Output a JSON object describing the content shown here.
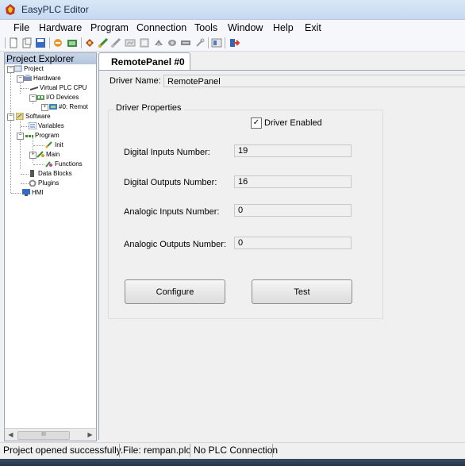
{
  "window": {
    "title": "EasyPLC Editor",
    "accent": "#c6d9f0"
  },
  "menu": [
    "File",
    "Hardware",
    "Program",
    "Connection",
    "Tools",
    "Window",
    "Help",
    "Exit"
  ],
  "toolbar_icons": [
    "new-icon",
    "open-icon",
    "save-icon",
    "compile-icon",
    "build-icon",
    "plc-icon",
    "run-icon",
    "stop-icon",
    "monitor-icon",
    "settings-icon",
    "plugin-icon",
    "chip-icon",
    "wrench-icon",
    "panel-icon",
    "exit-icon"
  ],
  "explorer": {
    "title": "Project Explorer",
    "tree": [
      {
        "label": "Project",
        "icon": "project-icon"
      },
      {
        "label": "Hardware",
        "icon": "hardware-icon"
      },
      {
        "label": "Virtual PLC CPU",
        "icon": "cpu-icon"
      },
      {
        "label": "I/O Devices",
        "icon": "io-devices-icon"
      },
      {
        "label": "#0: Remot",
        "icon": "device-icon"
      },
      {
        "label": "Software",
        "icon": "software-icon"
      },
      {
        "label": "Variables",
        "icon": "variables-icon"
      },
      {
        "label": "Program",
        "icon": "program-icon"
      },
      {
        "label": "Init",
        "icon": "init-icon"
      },
      {
        "label": "Main",
        "icon": "main-icon"
      },
      {
        "label": "Functions",
        "icon": "functions-icon"
      },
      {
        "label": "Data Blocks",
        "icon": "data-blocks-icon"
      },
      {
        "label": "Plugins",
        "icon": "plugins-icon"
      },
      {
        "label": "HMI",
        "icon": "hmi-icon"
      }
    ],
    "scroll_thumb": "III"
  },
  "tab": {
    "label": "RemotePanel #0"
  },
  "driver": {
    "name_label": "Driver Name:",
    "name_value": "RemotePanel"
  },
  "properties": {
    "title": "Driver Properties",
    "enabled_label": "Driver Enabled",
    "enabled": true,
    "fields": [
      {
        "label": "Digital Inputs Number:",
        "value": "19"
      },
      {
        "label": "Digital Outputs Number:",
        "value": "16"
      },
      {
        "label": "Analogic Inputs Number:",
        "value": "0"
      },
      {
        "label": "Analogic Outputs Number:",
        "value": "0"
      }
    ],
    "configure_label": "Configure",
    "test_label": "Test"
  },
  "status": {
    "message": "Project opened successfully.",
    "file": "File: rempan.plc",
    "connection": "No PLC Connection"
  }
}
